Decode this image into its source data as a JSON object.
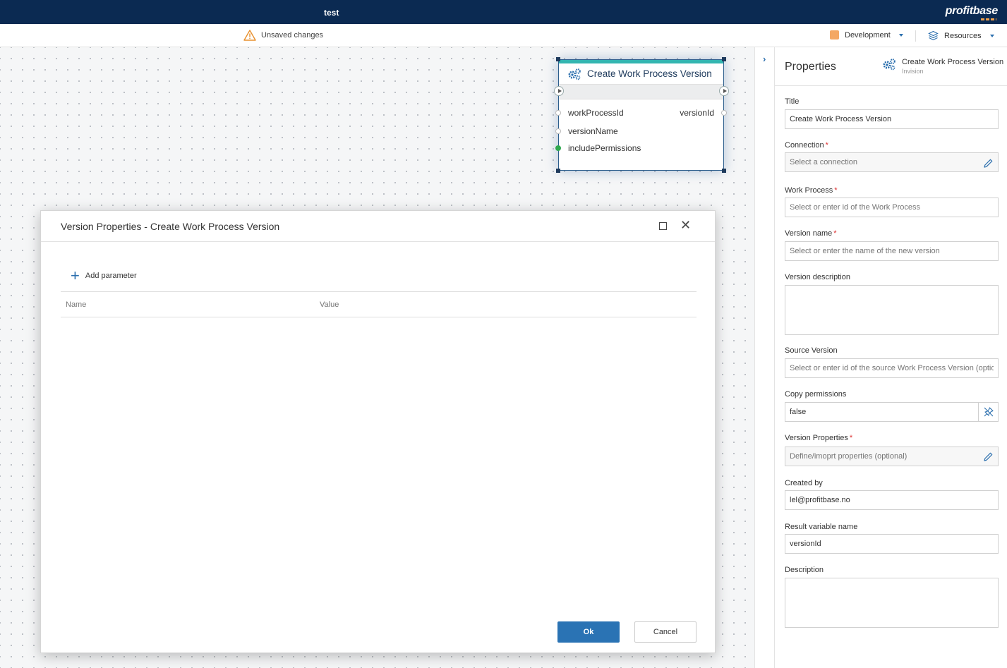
{
  "app": {
    "window_title": "test",
    "logo_text": "profitbase"
  },
  "subbar": {
    "unsaved_text": "Unsaved changes",
    "environment": "Development",
    "resources": "Resources"
  },
  "node": {
    "title": "Create Work Process Version",
    "inputs": [
      "workProcessId",
      "versionName",
      "includePermissions"
    ],
    "outputs": [
      "versionId"
    ]
  },
  "dialog": {
    "title": "Version Properties - Create Work Process Version",
    "add_parameter": "Add parameter",
    "columns": [
      "Name",
      "Value"
    ],
    "ok_label": "Ok",
    "cancel_label": "Cancel"
  },
  "properties": {
    "heading": "Properties",
    "node_name": "Create Work Process Version",
    "node_source": "Invision",
    "fields": {
      "title": {
        "label": "Title",
        "value": "Create Work Process Version"
      },
      "connection": {
        "label": "Connection",
        "placeholder": "Select a connection"
      },
      "work_process": {
        "label": "Work Process",
        "placeholder": "Select or enter id of the Work Process"
      },
      "version_name": {
        "label": "Version name",
        "placeholder": "Select or enter the name of the new version"
      },
      "version_description": {
        "label": "Version description"
      },
      "source_version": {
        "label": "Source Version",
        "placeholder": "Select or enter id of the source Work Process Version (optional)"
      },
      "copy_permissions": {
        "label": "Copy permissions",
        "value": "false"
      },
      "version_properties": {
        "label": "Version Properties",
        "placeholder": "Define/imoprt properties (optional)"
      },
      "created_by": {
        "label": "Created by",
        "value": "lel@profitbase.no"
      },
      "result_variable": {
        "label": "Result variable name",
        "value": "versionId"
      },
      "description": {
        "label": "Description"
      }
    },
    "required_mark": "*"
  },
  "colors": {
    "topbar": "#0b2a52",
    "accent": "#2a73b4",
    "node_accent": "#33b5b0",
    "env_swatch": "#f4a864"
  }
}
